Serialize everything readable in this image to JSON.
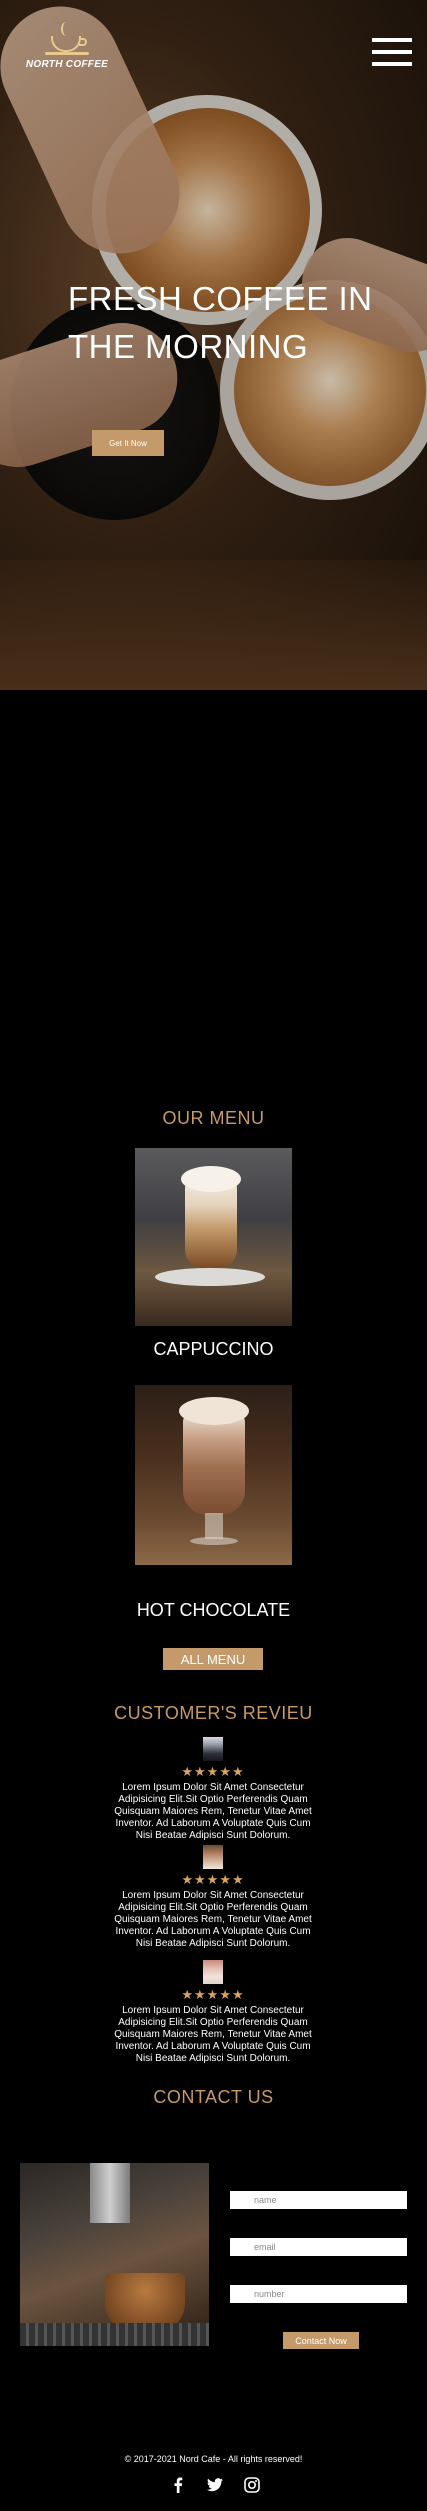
{
  "brand": {
    "name": "NORTH COFFEE"
  },
  "hero": {
    "title": "FRESH COFFEE IN THE MORNING",
    "cta_label": "Get It Now"
  },
  "menu": {
    "title": "OUR MENU",
    "items": [
      {
        "label": "CAPPUCCINO"
      },
      {
        "label": "HOT CHOCOLATE"
      }
    ],
    "all_menu_label": "ALL MENU"
  },
  "reviews": {
    "title": "CUSTOMER'S REVIEU",
    "items": [
      {
        "stars": "★★★★★",
        "text": "Lorem Ipsum Dolor Sit Amet Consectetur Adipisicing Elit.Sit Optio Perferendis Quam Quisquam Maiores Rem, Tenetur Vitae Amet Inventor. Ad Laborum A Voluptate Quis Cum Nisi Beatae Adipisci Sunt Dolorum."
      },
      {
        "stars": "★★★★★",
        "text": "Lorem Ipsum Dolor Sit Amet Consectetur Adipisicing Elit.Sit Optio Perferendis Quam Quisquam Maiores Rem, Tenetur Vitae Amet Inventor. Ad Laborum A Voluptate Quis Cum Nisi Beatae Adipisci Sunt Dolorum."
      },
      {
        "stars": "★★★★★",
        "text": "Lorem Ipsum Dolor Sit Amet Consectetur Adipisicing Elit.Sit Optio Perferendis Quam Quisquam Maiores Rem, Tenetur Vitae Amet Inventor. Ad Laborum A Voluptate Quis Cum Nisi Beatae Adipisci Sunt Dolorum."
      }
    ]
  },
  "contact": {
    "title": "CONTACT US",
    "name_placeholder": "name",
    "email_placeholder": "email",
    "number_placeholder": "number",
    "submit_label": "Contact Now"
  },
  "footer": {
    "copyright": "© 2017-2021 Nord Cafe - All rights reserved!",
    "socials": [
      "facebook-icon",
      "twitter-icon",
      "instagram-icon"
    ]
  },
  "colors": {
    "accent": "#c59a6a",
    "heading": "#c99a64",
    "stars": "#d9a45c",
    "background": "#000000"
  }
}
